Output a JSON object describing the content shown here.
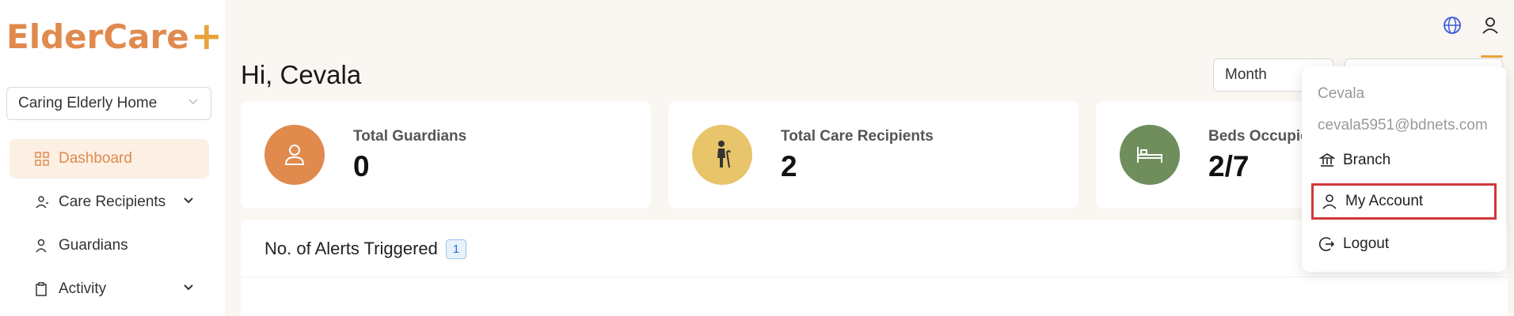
{
  "brand": {
    "logo_text": "ElderCare",
    "logo_plus": "+"
  },
  "sidebar": {
    "branch_select": "Caring Elderly Home",
    "items": [
      {
        "label": "Dashboard",
        "icon": "dashboard-grid-icon",
        "active": true
      },
      {
        "label": "Care Recipients",
        "icon": "care-recipients-icon",
        "expandable": true
      },
      {
        "label": "Guardians",
        "icon": "guardians-icon"
      },
      {
        "label": "Activity",
        "icon": "clipboard-icon",
        "expandable": true
      }
    ]
  },
  "header": {
    "greeting": "Hi, Cevala",
    "period": "Month"
  },
  "cards": [
    {
      "label": "Total Guardians",
      "value": "0",
      "icon": "person-icon",
      "color": "#e08a4e"
    },
    {
      "label": "Total Care Recipients",
      "value": "2",
      "icon": "elderly-cane-icon",
      "color": "#e8c46a"
    },
    {
      "label": "Beds Occupied",
      "value": "2/7",
      "icon": "bed-icon",
      "color": "#6f8e5c"
    }
  ],
  "alerts": {
    "title": "No. of Alerts Triggered",
    "count": "1"
  },
  "user_menu": {
    "name": "Cevala",
    "email": "cevala5951@bdnets.com",
    "items": [
      {
        "label": "Branch",
        "icon": "bank-icon"
      },
      {
        "label": "My Account",
        "icon": "user-icon",
        "highlighted": true
      },
      {
        "label": "Logout",
        "icon": "logout-icon"
      }
    ]
  },
  "colors": {
    "brand": "#e08a4e",
    "accent": "#e8a33a",
    "highlight_border": "#d0383a",
    "badge": "#2b6fd1"
  }
}
